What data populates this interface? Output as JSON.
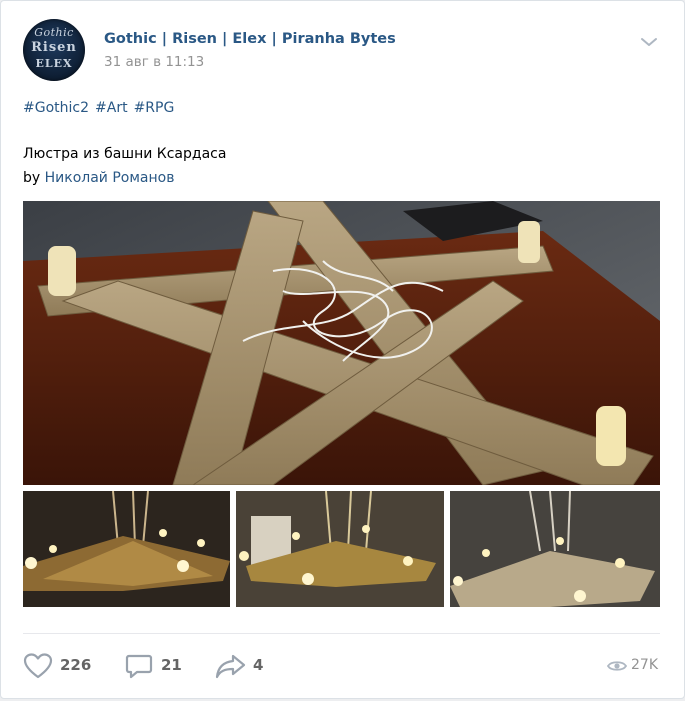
{
  "post": {
    "author": "Gothic | Risen | Elex | Piranha Bytes",
    "date": "31 авг в 11:13",
    "avatar_text": [
      "Gothic",
      "Risen",
      "ELEX"
    ],
    "hashtags": [
      "#Gothic2",
      "#Art",
      "#RPG"
    ],
    "title": "Люстра из башни Ксардаса",
    "by_prefix": "by",
    "by_author": "Николай Романов"
  },
  "photos": {
    "main": "wooden-pentagram-chandelier-on-table",
    "thumbs": [
      "chandelier-lit-candles-1",
      "chandelier-lit-candles-2",
      "chandelier-lit-candles-3"
    ]
  },
  "actions": {
    "likes": "226",
    "comments": "21",
    "shares": "4",
    "views": "27K"
  },
  "colors": {
    "link": "#2a5885",
    "muted": "#939393",
    "action_text": "#656565",
    "icon": "#99a2ad"
  }
}
